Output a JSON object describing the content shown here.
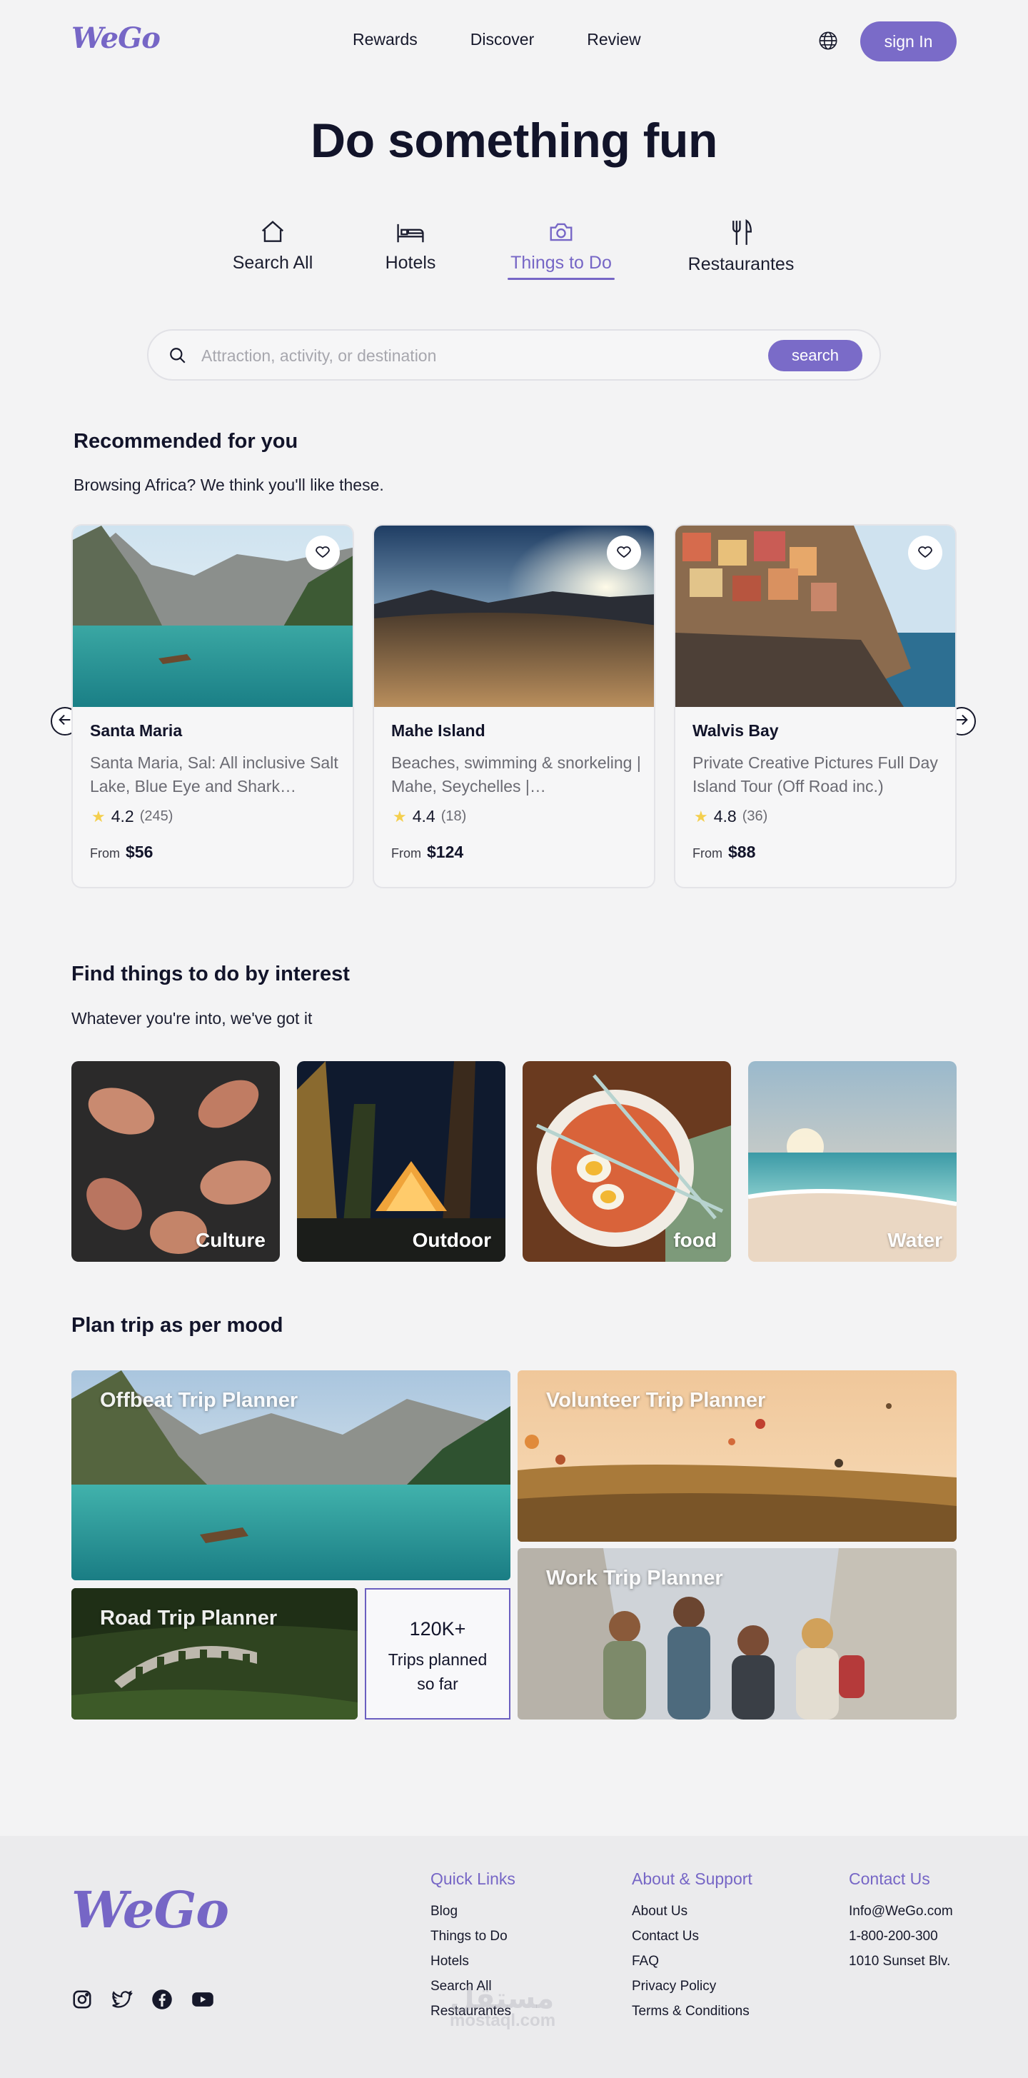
{
  "header": {
    "logo": "WeGo",
    "nav": [
      "Rewards",
      "Discover",
      "Review"
    ],
    "signin_label": "sign In"
  },
  "hero": {
    "title": "Do something fun"
  },
  "tabs": [
    {
      "label": "Search All",
      "icon": "home-icon"
    },
    {
      "label": "Hotels",
      "icon": "bed-icon"
    },
    {
      "label": "Things to Do",
      "icon": "camera-icon",
      "active": true
    },
    {
      "label": "Restaurantes",
      "icon": "fork-knife-icon"
    }
  ],
  "search": {
    "placeholder": "Attraction, activity, or destination",
    "value": "",
    "button_label": "search"
  },
  "recommended": {
    "title": "Recommended for you",
    "subtitle": "Browsing Africa? We think you'll like these.",
    "cards": [
      {
        "title": "Santa Maria",
        "desc": "Santa Maria, Sal: All inclusive Salt Lake, Blue Eye and Shark…",
        "rating": "4.2",
        "count": "(245)",
        "from": "From",
        "price": "$56"
      },
      {
        "title": "Mahe Island",
        "desc": "Beaches, swimming & snorkeling | Mahe, Seychelles |…",
        "rating": "4.4",
        "count": "(18)",
        "from": "From",
        "price": "$124"
      },
      {
        "title": "Walvis Bay",
        "desc": "Private Creative Pictures Full Day Island Tour (Off Road inc.)",
        "rating": "4.8",
        "count": "(36)",
        "from": "From",
        "price": "$88"
      }
    ]
  },
  "interest": {
    "title": "Find things to do by interest",
    "subtitle": "Whatever you're into, we've got it",
    "tiles": [
      "Culture",
      "Outdoor",
      "food",
      "Water"
    ]
  },
  "mood": {
    "title": "Plan trip as per mood",
    "offbeat": "Offbeat Trip Planner",
    "volunteer": "Volunteer Trip Planner",
    "road": "Road Trip Planner",
    "work": "Work Trip Planner",
    "stat_number": "120K+",
    "stat_text": "Trips planned so far"
  },
  "footer": {
    "logo": "WeGo",
    "quick_links": {
      "title": "Quick Links",
      "items": [
        "Blog",
        "Things to Do",
        "Hotels",
        "Search All",
        "Restaurantes"
      ]
    },
    "about": {
      "title": "About & Support",
      "items": [
        "About Us",
        "Contact Us",
        "FAQ",
        "Privacy Policy",
        "Terms & Conditions"
      ]
    },
    "contact": {
      "title": "Contact Us",
      "items": [
        "Info@WeGo.com",
        "1-800-200-300",
        "1010 Sunset Blv."
      ]
    },
    "watermark": "مستقل",
    "watermark_url": "mostaql.com"
  },
  "colors": {
    "accent": "#7a6bc8",
    "star": "#f4cf4e",
    "background": "#f3f3f4"
  }
}
